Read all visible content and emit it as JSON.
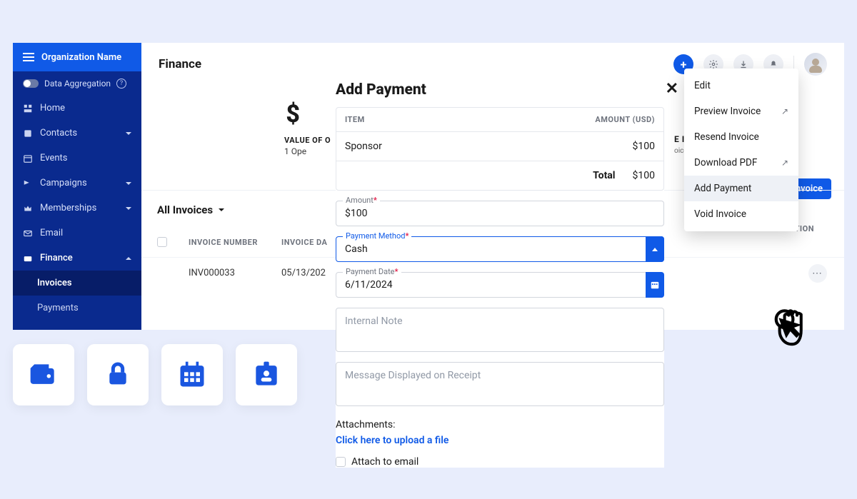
{
  "sidebar": {
    "org_name": "Organization Name",
    "data_aggregation": "Data Aggregation",
    "items": [
      {
        "label": "Home"
      },
      {
        "label": "Contacts"
      },
      {
        "label": "Events"
      },
      {
        "label": "Campaigns"
      },
      {
        "label": "Memberships"
      },
      {
        "label": "Email"
      },
      {
        "label": "Finance"
      }
    ],
    "sub": {
      "invoices": "Invoices",
      "payments": "Payments"
    }
  },
  "header": {
    "title": "Finance"
  },
  "summary": {
    "value_label": "VALUE OF O",
    "value_sub": "1 Ope",
    "right_label": "E INVOICES",
    "right_sub": "oices",
    "button_tail": "nvoice",
    "action_col": "ACTION"
  },
  "filter": {
    "all_invoices": "All Invoices"
  },
  "table": {
    "cols": {
      "inv": "INVOICE NUMBER",
      "date": "INVOICE DA"
    },
    "rows": [
      {
        "inv": "INV000033",
        "date": "05/13/202"
      }
    ]
  },
  "dropdown": {
    "edit": "Edit",
    "preview": "Preview Invoice",
    "resend": "Resend Invoice",
    "download": "Download PDF",
    "add_payment": "Add Payment",
    "void": "Void Invoice"
  },
  "modal": {
    "title": "Add Payment",
    "col_item": "ITEM",
    "col_amount": "AMOUNT (USD)",
    "row_item": "Sponsor",
    "row_amount": "$100",
    "total_label": "Total",
    "total_value": "$100",
    "amount_label": "Amount",
    "amount_value": "$100",
    "payment_method_label": "Payment Method",
    "payment_method_value": "Cash",
    "payment_date_label": "Payment Date",
    "payment_date_value": "6/11/2024",
    "internal_note_placeholder": "Internal Note",
    "receipt_placeholder": "Message Displayed on Receipt",
    "attachments_label": "Attachments:",
    "upload_link": "Click here to upload a file",
    "attach_email": "Attach to email"
  }
}
